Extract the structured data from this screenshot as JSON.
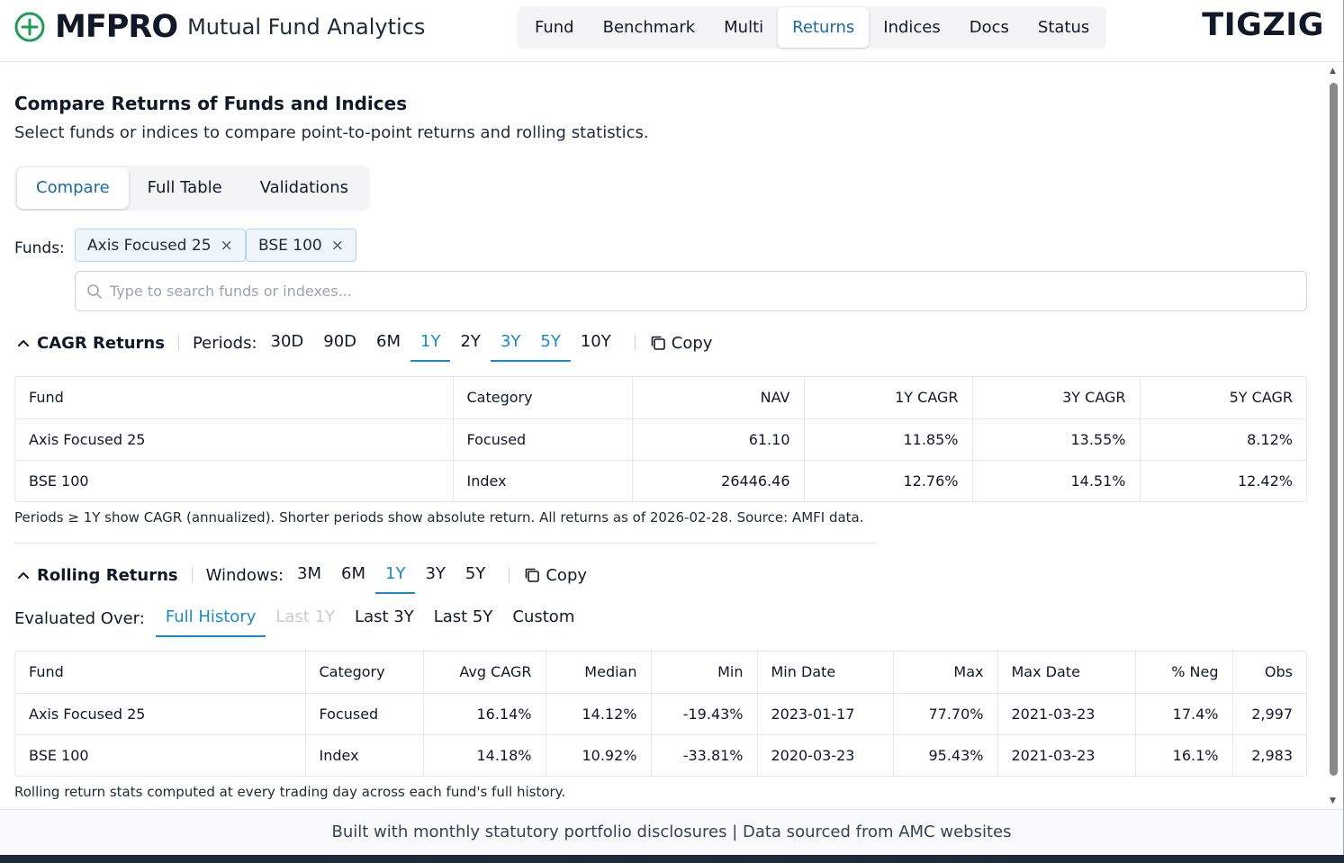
{
  "header": {
    "brand": "MFPRO",
    "brand_sub": "Mutual Fund Analytics",
    "right_brand": "TIGZIG",
    "nav": [
      "Fund",
      "Benchmark",
      "Multi",
      "Returns",
      "Indices",
      "Docs",
      "Status"
    ],
    "active_nav": "Returns"
  },
  "page": {
    "title": "Compare Returns of Funds and Indices",
    "subtitle": "Select funds or indices to compare point-to-point returns and rolling statistics.",
    "tabs": [
      "Compare",
      "Full Table",
      "Validations"
    ],
    "active_tab": "Compare"
  },
  "funds": {
    "label": "Funds:",
    "selected": [
      "Axis Focused 25",
      "BSE 100"
    ],
    "remove_glyph": "×",
    "search_placeholder": "Type to search funds or indexes...",
    "search_value": ""
  },
  "cagr": {
    "title": "CAGR Returns",
    "periods_label": "Periods:",
    "periods": [
      "30D",
      "90D",
      "6M",
      "1Y",
      "2Y",
      "3Y",
      "5Y",
      "10Y"
    ],
    "active_periods": [
      "1Y",
      "3Y",
      "5Y"
    ],
    "copy_label": "Copy",
    "columns": [
      "Fund",
      "Category",
      "NAV",
      "1Y CAGR",
      "3Y CAGR",
      "5Y CAGR"
    ],
    "rows": [
      [
        "Axis Focused 25",
        "Focused",
        "61.10",
        "11.85%",
        "13.55%",
        "8.12%"
      ],
      [
        "BSE 100",
        "Index",
        "26446.46",
        "12.76%",
        "14.51%",
        "12.42%"
      ]
    ],
    "note": "Periods ≥ 1Y show CAGR (annualized). Shorter periods show absolute return. All returns as of 2026-02-28. Source: AMFI data."
  },
  "rolling": {
    "title": "Rolling Returns",
    "windows_label": "Windows:",
    "windows": [
      "3M",
      "6M",
      "1Y",
      "3Y",
      "5Y"
    ],
    "active_window": "1Y",
    "copy_label": "Copy",
    "evaluated_label": "Evaluated Over:",
    "evaluated_options": [
      "Full History",
      "Last 1Y",
      "Last 3Y",
      "Last 5Y",
      "Custom"
    ],
    "active_evaluated": "Full History",
    "disabled_evaluated": [
      "Last 1Y"
    ],
    "columns": [
      "Fund",
      "Category",
      "Avg CAGR",
      "Median",
      "Min",
      "Min Date",
      "Max",
      "Max Date",
      "% Neg",
      "Obs"
    ],
    "rows": [
      [
        "Axis Focused 25",
        "Focused",
        "16.14%",
        "14.12%",
        "-19.43%",
        "2023-01-17",
        "77.70%",
        "2021-03-23",
        "17.4%",
        "2,997"
      ],
      [
        "BSE 100",
        "Index",
        "14.18%",
        "10.92%",
        "-33.81%",
        "2020-03-23",
        "95.43%",
        "2021-03-23",
        "16.1%",
        "2,983"
      ]
    ],
    "note": "Rolling return stats computed at every trading day across each fund's full history."
  },
  "footer": {
    "text": "Built with monthly statutory portfolio disclosures | Data sourced from AMC websites"
  },
  "colors": {
    "accent": "#1a8ac8",
    "accent_dark": "#1a6aa0",
    "logo_green": "#1f9d55"
  }
}
